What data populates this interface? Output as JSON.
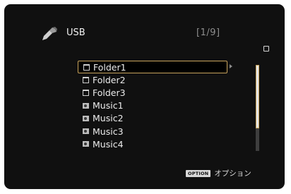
{
  "header": {
    "source_label": "USB",
    "page_count": "[1/9]"
  },
  "list": {
    "items": [
      {
        "label": "Folder1",
        "type": "folder",
        "selected": true
      },
      {
        "label": "Folder2",
        "type": "folder",
        "selected": false
      },
      {
        "label": "Folder3",
        "type": "folder",
        "selected": false
      },
      {
        "label": "Music1",
        "type": "music",
        "selected": false
      },
      {
        "label": "Music2",
        "type": "music",
        "selected": false
      },
      {
        "label": "Music3",
        "type": "music",
        "selected": false
      },
      {
        "label": "Music4",
        "type": "music",
        "selected": false
      }
    ]
  },
  "scrollbar": {
    "visible_fraction": 0.74
  },
  "footer": {
    "option_badge": "OPTION",
    "option_label": "オプション"
  },
  "colors": {
    "screen_bg": "#101010",
    "selection_border": "#c9a45c",
    "text": "#ececec"
  }
}
